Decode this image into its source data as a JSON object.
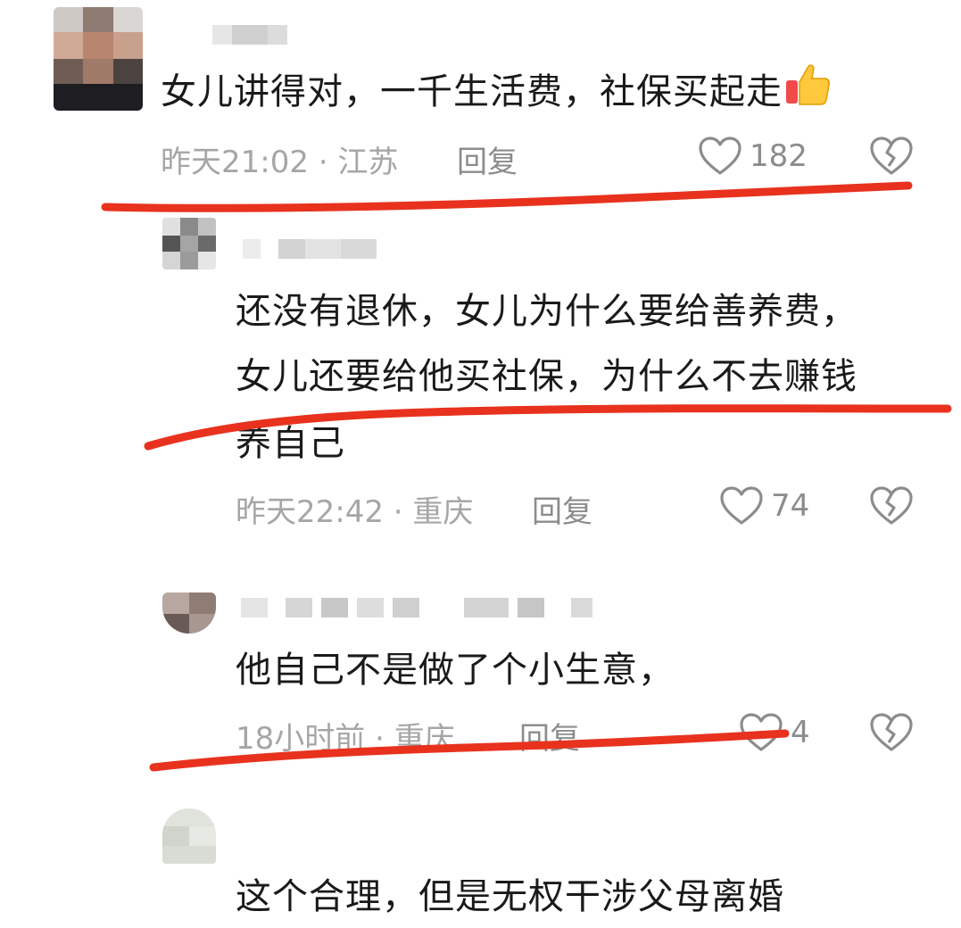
{
  "comments": [
    {
      "text": "女儿讲得对，一千生活费，社保买起走",
      "time": "昨天21:02",
      "sep": "·",
      "location": "江苏",
      "reply_label": "回复",
      "likes": "182"
    },
    {
      "text_line1": "还没有退休，女儿为什么要给善养费，",
      "text_line2": "女儿还要给他买社保，为什么不去赚钱",
      "text_line3": "养自己",
      "time": "昨天22:42",
      "sep": "·",
      "location": "重庆",
      "reply_label": "回复",
      "likes": "74"
    },
    {
      "text": "他自己不是做了个小生意，",
      "time": "18小时前",
      "sep": "·",
      "location": "重庆",
      "reply_label": "回复",
      "likes": "4"
    },
    {
      "text": "这个合理，但是无权干涉父母离婚"
    }
  ],
  "colors": {
    "annotation_red": "#e8321e",
    "meta_gray": "#a6a6a6",
    "icon_gray": "#8c8c8c"
  },
  "icons": {
    "like": "heart-outline-icon",
    "dislike": "broken-heart-icon",
    "thumbs_up": "thumbs-up-emoji"
  }
}
